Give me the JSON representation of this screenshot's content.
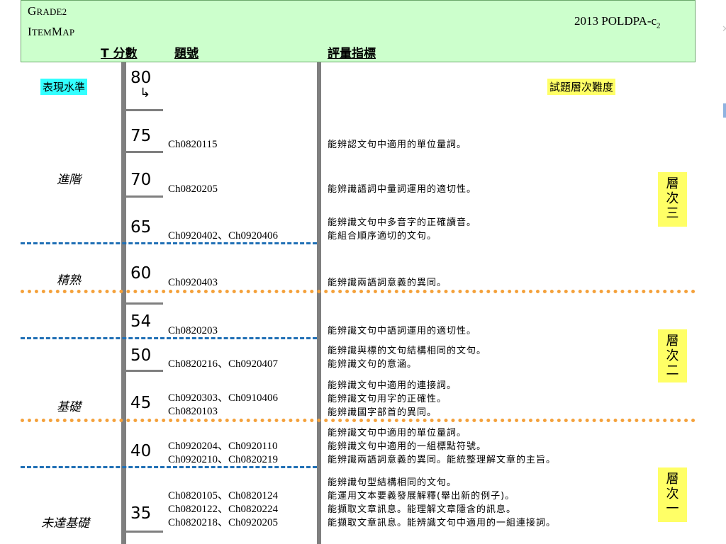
{
  "header": {
    "title_line1_cap": "G",
    "title_line1_rest": "RADE2",
    "title_line2_cap1": "I",
    "title_line2_rest1": "TEM",
    "title_line2_cap2": "M",
    "title_line2_rest2": "AP",
    "doc_code_main": "2013 POLDPA-c",
    "doc_code_sub": "2",
    "col_score": "T 分數",
    "col_item": "題號",
    "col_indicator": "評量指標"
  },
  "labels": {
    "performance_level": "表現水準",
    "difficulty": "試題層次難度",
    "top_arrow": "↳"
  },
  "levels": [
    "進階",
    "精熟",
    "基礎",
    "未達基礎"
  ],
  "tiers": [
    [
      "層",
      "次",
      "三"
    ],
    [
      "層",
      "次",
      "二"
    ],
    [
      "層",
      "次",
      "一"
    ]
  ],
  "scores": [
    "80",
    "75",
    "70",
    "65",
    "60",
    "54",
    "50",
    "45",
    "40",
    "35"
  ],
  "rows": [
    {
      "codes": [
        "Ch0820115"
      ],
      "indicators": [
        "能辨認文句中適用的單位量詞。"
      ]
    },
    {
      "codes": [
        "Ch0820205"
      ],
      "indicators": [
        "能辨識語詞中量詞運用的適切性。"
      ]
    },
    {
      "codes": [
        "Ch0920402、Ch0920406"
      ],
      "indicators": [
        "能辨識文句中多音字的正確讀音。",
        "能組合順序適切的文句。"
      ]
    },
    {
      "codes": [
        "Ch0920403"
      ],
      "indicators": [
        "能辨識兩語詞意義的異同。"
      ]
    },
    {
      "codes": [
        "Ch0820203"
      ],
      "indicators": [
        "能辨識文句中語詞運用的適切性。"
      ]
    },
    {
      "codes": [
        "Ch0820216、Ch0920407"
      ],
      "indicators": [
        "能辨識與標的文句結構相同的文句。",
        "能辨識文句的意涵。"
      ]
    },
    {
      "codes": [
        "Ch0920303、Ch0910406",
        "Ch0820103"
      ],
      "indicators": [
        "能辨識文句中適用的連接詞。",
        "能辨識文句用字的正確性。",
        "能辨識國字部首的異同。"
      ]
    },
    {
      "codes": [
        "Ch0920204、Ch0920110",
        "Ch0920210、Ch0820219"
      ],
      "indicators": [
        "能辨識文句中適用的單位量詞。",
        "能辨識文句中適用的一組標點符號。",
        "能辨識兩語詞意義的異同。能統整理解文章的主旨。"
      ]
    },
    {
      "codes": [
        "Ch0820105、Ch0820124",
        "Ch0820122、Ch0820224",
        "Ch0820218、Ch0920205"
      ],
      "indicators": [
        "能辨識句型結構相同的文句。",
        "能運用文本要義發展解釋(舉出新的例子)。",
        "能擷取文章訊息。能理解文章隱含的訊息。",
        "能擷取文章訊息。能辨識文句中適用的一組連接詞。"
      ]
    }
  ]
}
